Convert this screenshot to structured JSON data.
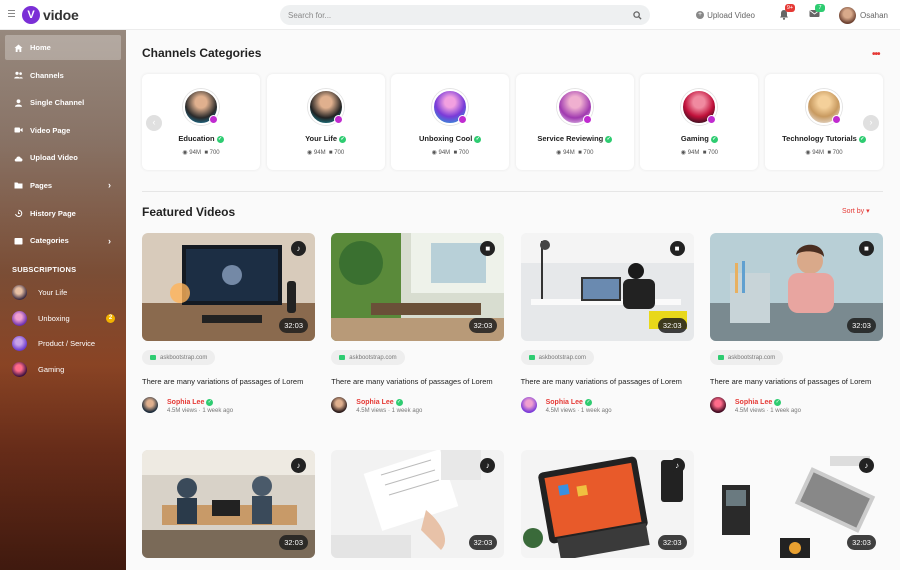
{
  "header": {
    "logo_letter": "V",
    "logo_text": "vidoe",
    "search_placeholder": "Search for...",
    "upload_label": "Upload Video",
    "notifications_count": "9+",
    "messages_count": "7",
    "user_name": "Osahan"
  },
  "sidebar": {
    "items": [
      {
        "label": "Home",
        "icon": "home-icon"
      },
      {
        "label": "Channels",
        "icon": "users-icon"
      },
      {
        "label": "Single Channel",
        "icon": "user-icon"
      },
      {
        "label": "Video Page",
        "icon": "video-camera-icon"
      },
      {
        "label": "Upload Video",
        "icon": "cloud-upload-icon"
      },
      {
        "label": "Pages",
        "icon": "folder-icon"
      },
      {
        "label": "History Page",
        "icon": "history-icon"
      },
      {
        "label": "Categories",
        "icon": "list-icon"
      }
    ],
    "subscriptions_title": "SUBSCRIPTIONS",
    "subscriptions": [
      {
        "label": "Your Life"
      },
      {
        "label": "Unboxing",
        "badge": "2"
      },
      {
        "label": "Product / Service"
      },
      {
        "label": "Gaming"
      }
    ]
  },
  "categories": {
    "title": "Channels Categories",
    "items": [
      {
        "name": "Education",
        "views": "94M",
        "videos": "700"
      },
      {
        "name": "Your Life",
        "views": "94M",
        "videos": "700"
      },
      {
        "name": "Unboxing Cool",
        "views": "94M",
        "videos": "700"
      },
      {
        "name": "Service Reviewing",
        "views": "94M",
        "videos": "700"
      },
      {
        "name": "Gaming",
        "views": "94M",
        "videos": "700"
      },
      {
        "name": "Technology Tutorials",
        "views": "94M",
        "videos": "700"
      }
    ]
  },
  "featured": {
    "title": "Featured Videos",
    "sort_label": "Sort by",
    "videos": [
      {
        "duration": "32:03",
        "media": "music-icon",
        "site": "askbootstrap.com",
        "title": "There are many variations of passages of Lorem",
        "author": "Sophia Lee",
        "meta": "4.5M views · 1 week ago"
      },
      {
        "duration": "32:03",
        "media": "video-icon",
        "site": "askbootstrap.com",
        "title": "There are many variations of passages of Lorem",
        "author": "Sophia Lee",
        "meta": "4.5M views · 1 week ago"
      },
      {
        "duration": "32:03",
        "media": "video-icon",
        "site": "askbootstrap.com",
        "title": "There are many variations of passages of Lorem",
        "author": "Sophia Lee",
        "meta": "4.5M views · 1 week ago"
      },
      {
        "duration": "32:03",
        "media": "video-icon",
        "site": "askbootstrap.com",
        "title": "There are many variations of passages of Lorem",
        "author": "Sophia Lee",
        "meta": "4.5M views · 1 week ago"
      },
      {
        "duration": "32:03",
        "media": "music-icon"
      },
      {
        "duration": "32:03",
        "media": "music-icon"
      },
      {
        "duration": "32:03",
        "media": "music-icon"
      },
      {
        "duration": "32:03",
        "media": "music-icon"
      }
    ]
  }
}
